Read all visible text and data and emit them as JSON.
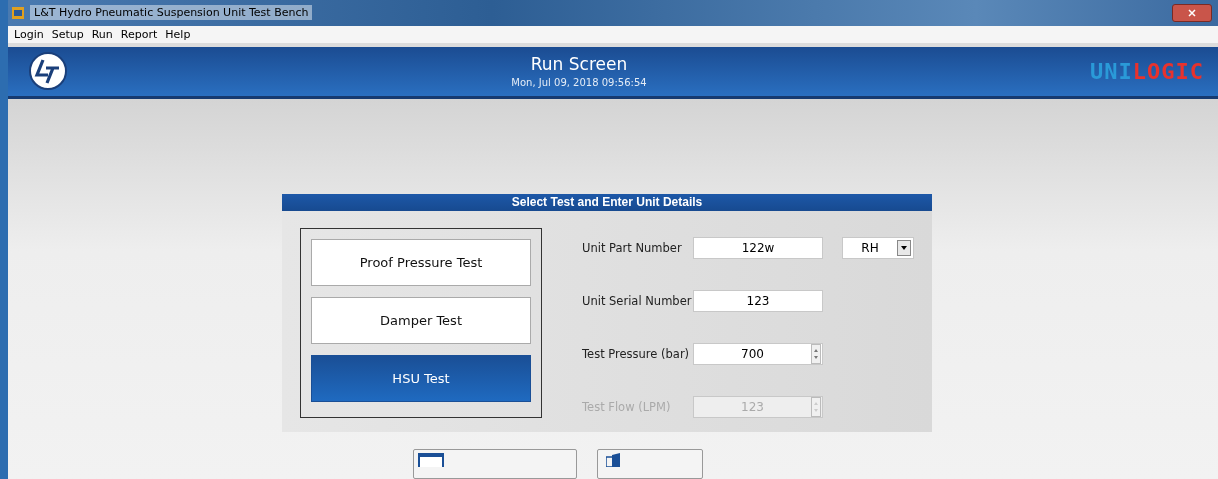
{
  "window": {
    "title": "L&T Hydro Pneumatic Suspension Unit Test Bench"
  },
  "menu": [
    "Login",
    "Setup",
    "Run",
    "Report",
    "Help"
  ],
  "header": {
    "title": "Run Screen",
    "datetime": "Mon, Jul 09, 2018 09:56:54",
    "brand": [
      "UNI",
      "LOGIC"
    ]
  },
  "panel": {
    "title": "Select Test and Enter Unit Details",
    "tests": [
      {
        "label": "Proof Pressure Test",
        "selected": false
      },
      {
        "label": "Damper Test",
        "selected": false
      },
      {
        "label": "HSU Test",
        "selected": true
      }
    ],
    "fields": [
      {
        "kind": "text",
        "label": "Unit Part Number",
        "value": "122w",
        "disabled": false,
        "dropdown": "RH"
      },
      {
        "kind": "text",
        "label": "Unit Serial Number",
        "value": "123",
        "disabled": false
      },
      {
        "kind": "spin",
        "label": "Test Pressure (bar)",
        "value": "700",
        "disabled": false
      },
      {
        "kind": "spin",
        "label": "Test Flow (LPM)",
        "value": "123",
        "disabled": true
      }
    ]
  }
}
